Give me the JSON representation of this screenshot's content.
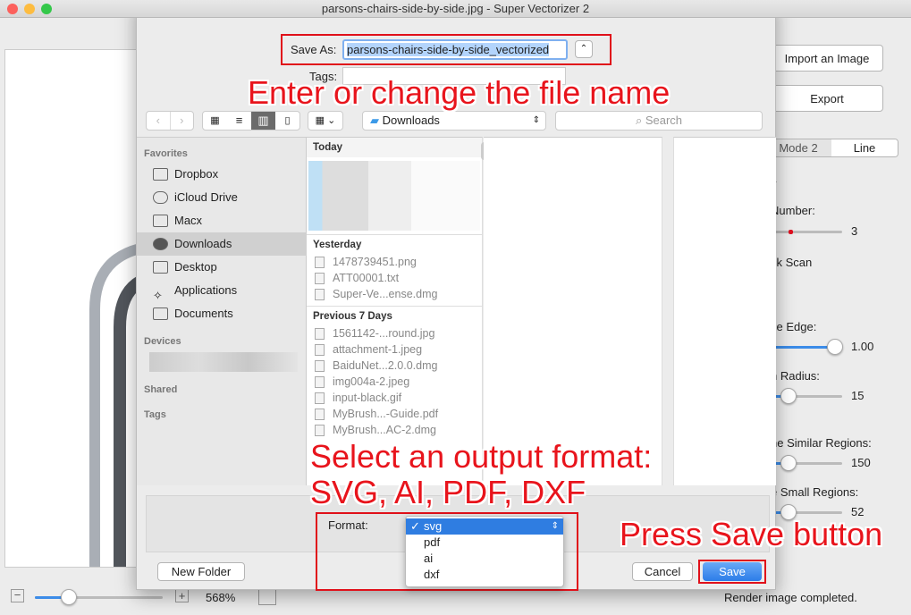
{
  "window": {
    "title": "parsons-chairs-side-by-side.jpg - Super Vectorizer 2"
  },
  "right_panel": {
    "import_label": "Import an Image",
    "export_label": "Export",
    "modes": [
      "Mode 2",
      "Line"
    ],
    "labels": [
      "y",
      "Number:",
      "ck Scan",
      "ce Edge:",
      "h Radius:",
      "ne Similar Regions:",
      "e Small Regions:"
    ],
    "values": {
      "number": "3",
      "edge": "1.00",
      "radius": "15",
      "similar": "150",
      "small": "52"
    },
    "slider_fraction": {
      "edge": 1.0,
      "radius": 0.25,
      "similar": 0.25,
      "small": 0.25
    }
  },
  "bottom_bar": {
    "zoom": "568%",
    "status": "Render image completed.",
    "zoom_fraction": 0.28
  },
  "dialog": {
    "save_as_label": "Save As:",
    "filename": "parsons-chairs-side-by-side_vectorized",
    "tags_label": "Tags:",
    "location": "Downloads",
    "search_placeholder": "Search",
    "sidebar": {
      "favorites_header": "Favorites",
      "favorites": [
        "Dropbox",
        "iCloud Drive",
        "Macx",
        "Downloads",
        "Desktop",
        "Applications",
        "Documents"
      ],
      "selected": "Downloads",
      "devices_header": "Devices",
      "shared_header": "Shared",
      "tags_header": "Tags"
    },
    "groups": [
      {
        "title": "Today",
        "files": []
      },
      {
        "title": "Yesterday",
        "files": [
          "1478739451.png",
          "ATT00001.txt",
          "Super-Ve...ense.dmg"
        ]
      },
      {
        "title": "Previous 7 Days",
        "files": [
          "1561142-...round.jpg",
          "attachment-1.jpeg",
          "BaiduNet...2.0.0.dmg",
          "img004a-2.jpeg",
          "input-black.gif",
          "MyBrush...-Guide.pdf",
          "MyBrush...AC-2.dmg"
        ]
      }
    ],
    "format_label": "Format:",
    "formats": [
      "svg",
      "pdf",
      "ai",
      "dxf"
    ],
    "selected_format": "svg",
    "new_folder_label": "New Folder",
    "cancel_label": "Cancel",
    "save_label": "Save"
  },
  "annotations": {
    "filename": "Enter or change the file name",
    "format_line1": "Select an output format:",
    "format_line2": "SVG, AI, PDF, DXF",
    "save": "Press Save button"
  },
  "colors": {
    "accent": "#3c8ce8",
    "annotation": "#e8141c",
    "selection": "#b3d4fc"
  }
}
